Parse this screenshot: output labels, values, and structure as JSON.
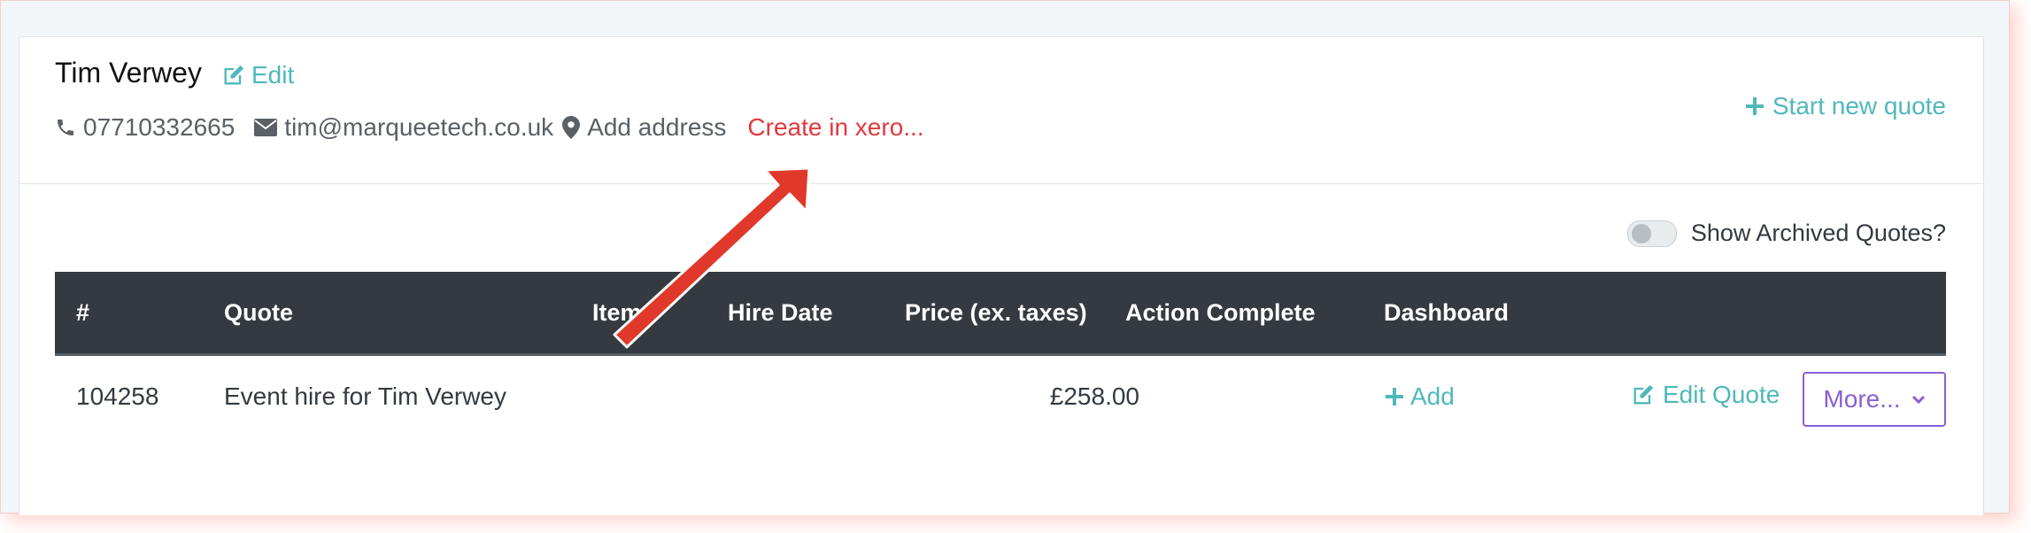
{
  "customer": {
    "name": "Tim Verwey",
    "edit_label": "Edit",
    "phone": "07710332665",
    "email": "tim@marqueetech.co.uk",
    "address_label": "Add address",
    "xero_label": "Create in xero..."
  },
  "actions": {
    "start_new_quote": "Start new quote",
    "show_archived": "Show Archived Quotes?"
  },
  "table": {
    "headers": [
      "#",
      "Quote",
      "Items",
      "Hire Date",
      "Price (ex. taxes)",
      "Action Complete",
      "Dashboard"
    ],
    "rows": [
      {
        "id": "104258",
        "quote": "Event hire for Tim Verwey",
        "items": "",
        "hire_date": "",
        "price": "£258.00",
        "action_complete": "",
        "dashboard": "Add",
        "edit_label": "Edit Quote",
        "more_label": "More..."
      }
    ]
  },
  "colors": {
    "accent": "#4fb8b9",
    "xero_link": "#e0393e",
    "header_bg": "#343a40",
    "more_button": "#8a5fd6",
    "arrow": "#e0392b"
  },
  "icons": [
    "edit-icon",
    "phone-icon",
    "envelope-icon",
    "map-marker-icon",
    "plus-icon",
    "chevron-down-icon",
    "annotation-arrow"
  ]
}
